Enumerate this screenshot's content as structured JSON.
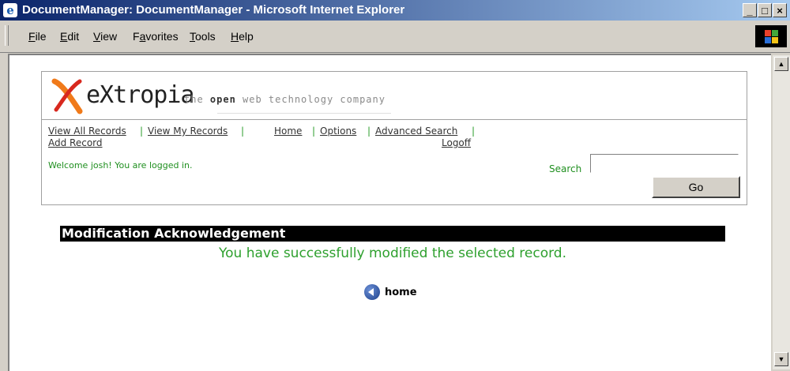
{
  "window": {
    "title": "DocumentManager: DocumentManager - Microsoft Internet Explorer",
    "controls": {
      "minimize": "_",
      "maximize": "□",
      "close": "×"
    }
  },
  "menubar": {
    "items": [
      {
        "label": "File",
        "accel": "F",
        "rest": "ile"
      },
      {
        "label": "Edit",
        "accel": "E",
        "rest": "dit"
      },
      {
        "label": "View",
        "accel": "V",
        "rest": "iew"
      },
      {
        "label": "Favorites",
        "pre": "F",
        "accel": "a",
        "rest": "vorites"
      },
      {
        "label": "Tools",
        "accel": "T",
        "rest": "ools"
      },
      {
        "label": "Help",
        "accel": "H",
        "rest": "elp"
      }
    ]
  },
  "logo": {
    "name": "eXtropia",
    "tagline_pre": "the ",
    "tagline_bold": "open",
    "tagline_post": " web technology company",
    "colors": {
      "x_orange": "#f07a1a",
      "x_red": "#d8281e"
    }
  },
  "nav": {
    "view_all": "View All Records",
    "view_my": "View My Records",
    "add_record": "Add Record",
    "home": "Home",
    "options": "Options",
    "advanced_search": "Advanced Search",
    "logoff": "Logoff",
    "separator": "|"
  },
  "welcome": "Welcome josh! You are logged in.",
  "search": {
    "label": "Search",
    "value": "",
    "button": "Go"
  },
  "main": {
    "heading": "Modification Acknowledgement",
    "message": "You have successfully modified the selected record.",
    "home_link": "home"
  },
  "colors": {
    "accent_green": "#2ea02e",
    "heading_bg": "#000000",
    "titlebar": "#0a246a"
  }
}
